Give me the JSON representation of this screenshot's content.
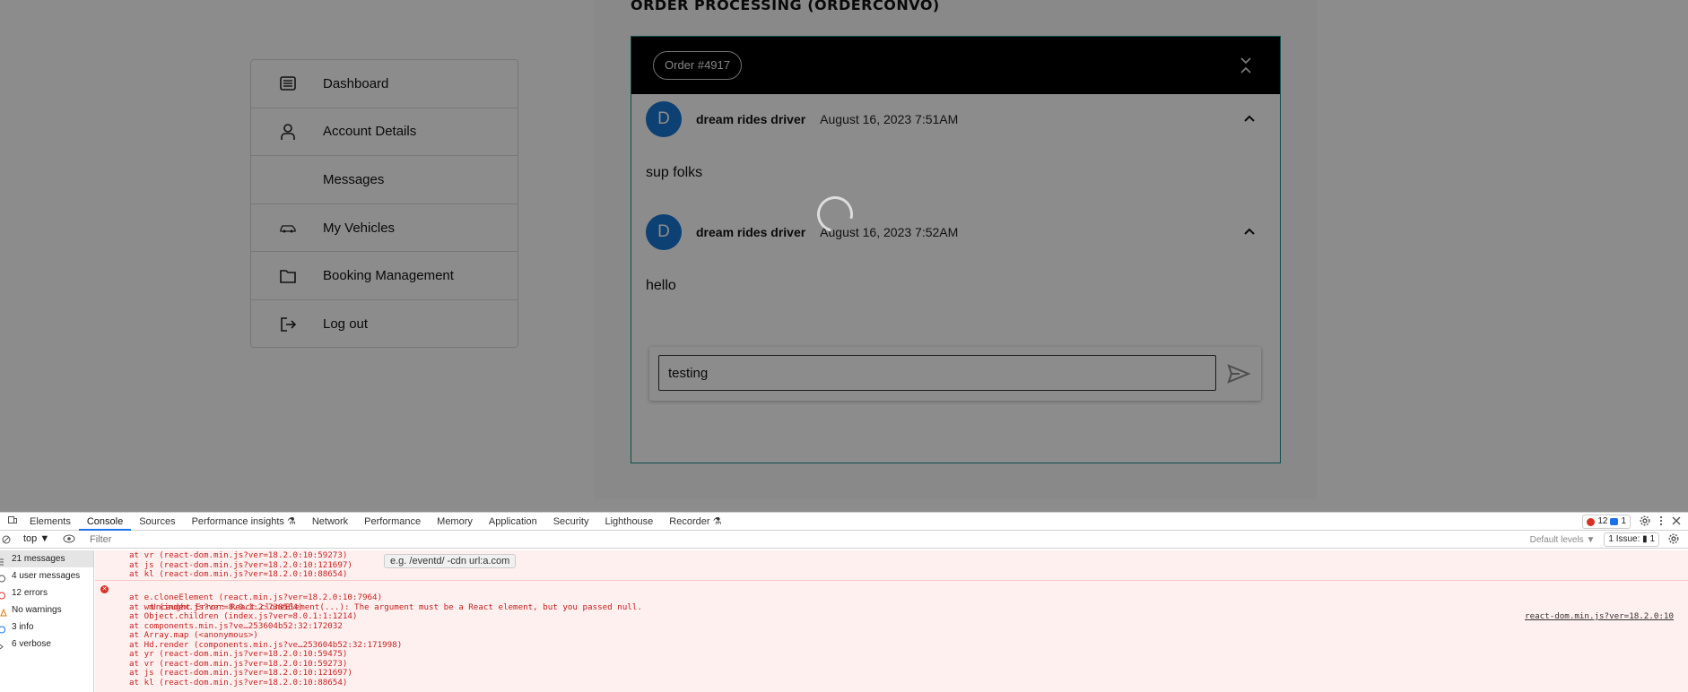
{
  "page": {
    "title": "ORDER PROCESSING (ORDERCONVO)"
  },
  "sidebar": {
    "items": [
      {
        "label": "Dashboard",
        "icon": "dashboard-icon"
      },
      {
        "label": "Account Details",
        "icon": "person-icon"
      },
      {
        "label": "Messages",
        "icon": ""
      },
      {
        "label": "My Vehicles",
        "icon": "car-icon"
      },
      {
        "label": "Booking Management",
        "icon": "folder-icon"
      },
      {
        "label": "Log out",
        "icon": "logout-icon"
      }
    ]
  },
  "conversation": {
    "order_label": "Order #4917",
    "messages": [
      {
        "avatar": "D",
        "sender": "dream rides driver",
        "time": "August 16, 2023 7:51AM",
        "body": "sup folks"
      },
      {
        "avatar": "D",
        "sender": "dream rides driver",
        "time": "August 16, 2023 7:52AM",
        "body": "hello"
      }
    ],
    "input_value": "testing"
  },
  "devtools": {
    "tabs": [
      "Elements",
      "Console",
      "Sources",
      "Performance insights ⚗",
      "Network",
      "Performance",
      "Memory",
      "Application",
      "Security",
      "Lighthouse",
      "Recorder ⚗"
    ],
    "error_count": "12",
    "info_count": "1",
    "context": "top ▼",
    "filter_placeholder": "Filter",
    "default_levels": "Default levels ▼",
    "issues": "1 Issue: ▮ 1",
    "side_items": [
      "21 messages",
      "4 user messages",
      "12 errors",
      "No warnings",
      "3 info",
      "6 verbose"
    ],
    "tooltip": "e.g. /eventd/ -cdn url:a.com",
    "log_lines_top": [
      "at vr (react-dom.min.js?ver=18.2.0:10:59273)",
      "at js (react-dom.min.js?ver=18.2.0:10:121697)",
      "at kl (react-dom.min.js?ver=18.2.0:10:88654)"
    ],
    "error_message": "Uncaught Error: React.cloneElement(...): The argument must be a React element, but you passed null.",
    "error_source": "react-dom.min.js?ver=18.2.0:10",
    "log_lines_bottom": [
      "at e.cloneElement (react.min.js?ver=18.2.0:10:7964)",
      "at wm (index.js?ver=8.0.1:2:738564)",
      "at Object.children (index.js?ver=8.0.1:1:1214)",
      "at components.min.js?ve…253604b52:32:172032",
      "at Array.map (<anonymous>)",
      "at Hd.render (components.min.js?ve…253604b52:32:171998)",
      "at yr (react-dom.min.js?ver=18.2.0:10:59475)",
      "at vr (react-dom.min.js?ver=18.2.0:10:59273)",
      "at js (react-dom.min.js?ver=18.2.0:10:121697)",
      "at kl (react-dom.min.js?ver=18.2.0:10:88654)"
    ]
  }
}
